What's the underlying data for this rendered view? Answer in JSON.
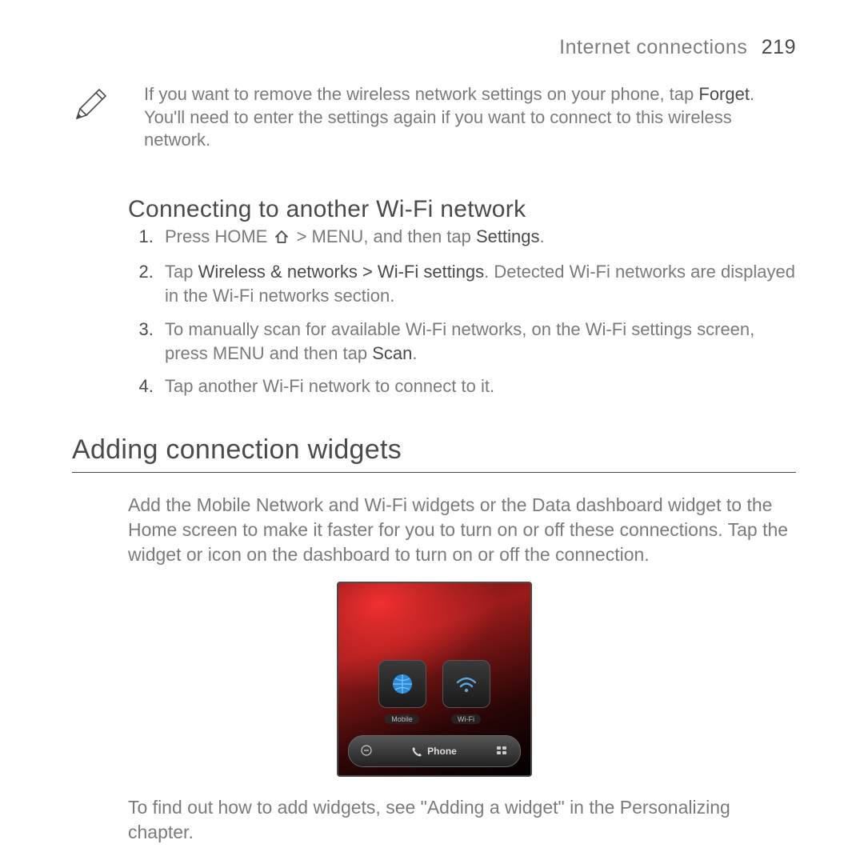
{
  "header": {
    "chapter": "Internet connections",
    "pagenum": "219"
  },
  "note": {
    "before": "If you want to remove the wireless network settings on your phone, tap ",
    "strong": "Forget",
    "after": ". You'll need to enter the settings again if you want to connect to this wireless network."
  },
  "subheading": "Connecting to another Wi-Fi network",
  "steps": {
    "s1": {
      "a": "Press HOME ",
      "b": " > MENU, and then tap ",
      "c": "Settings",
      "d": "."
    },
    "s2": {
      "a": "Tap ",
      "b": "Wireless & networks > Wi-Fi settings",
      "c": ". Detected Wi-Fi networks are displayed in the Wi-Fi networks section."
    },
    "s3": {
      "a": "To manually scan for available Wi-Fi networks, on the Wi-Fi settings screen, press MENU and then tap ",
      "b": "Scan",
      "c": "."
    },
    "s4": {
      "a": "Tap another Wi-Fi network to connect to it."
    }
  },
  "section_heading": "Adding connection widgets",
  "para1": "Add the Mobile Network and Wi-Fi widgets or the Data dashboard widget to the Home screen to make it faster for you to turn on or off these connections. Tap the widget or icon on the dashboard to turn on or off the connection.",
  "figure": {
    "icon1_label": "Mobile",
    "icon2_label": "Wi-Fi",
    "dock_center": "Phone"
  },
  "para2": "To find out how to add widgets, see \"Adding a widget\" in the Personalizing chapter."
}
